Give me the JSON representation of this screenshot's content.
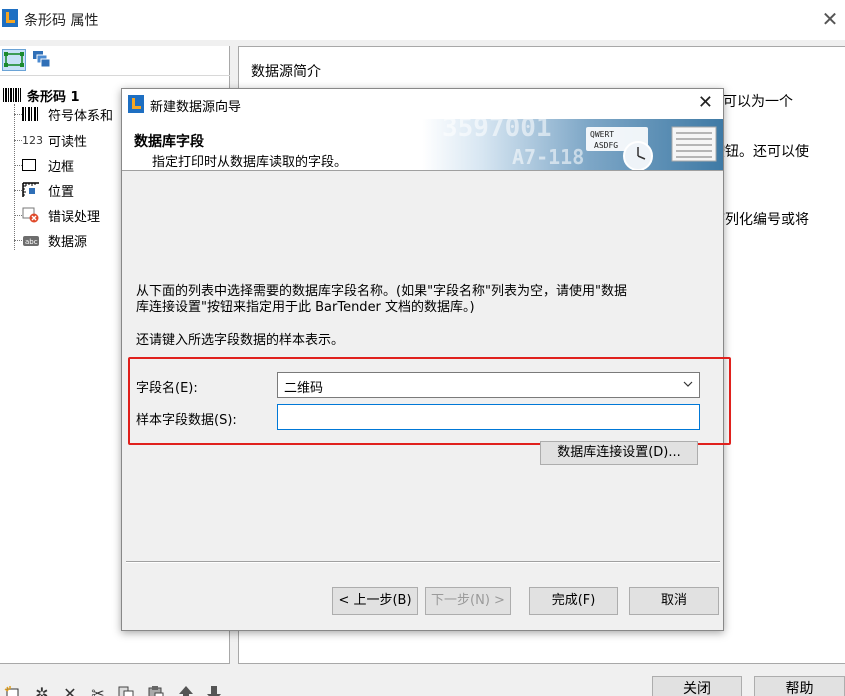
{
  "outer": {
    "title": "条形码 属性",
    "tree": {
      "root_label": "条形码 1",
      "items": [
        {
          "label": "符号体系和",
          "icon": "barcode-icon"
        },
        {
          "label": "可读性",
          "icon": "digits-icon"
        },
        {
          "label": "边框",
          "icon": "border-icon"
        },
        {
          "label": "位置",
          "icon": "position-icon"
        },
        {
          "label": "错误处理",
          "icon": "error-icon"
        },
        {
          "label": "数据源",
          "icon": "datasource-icon"
        }
      ]
    },
    "right_panel": {
      "heading": "数据源简介",
      "frag1": "上。可以为一个",
      "frag2": "按钮。还可以使",
      "frag3": "序列化编号或将"
    },
    "buttons": {
      "close": "关闭",
      "help": "帮助"
    }
  },
  "dialog": {
    "title": "新建数据源向导",
    "header_title": "数据库字段",
    "header_subtitle": "指定打印时从数据库读取的字段。",
    "banner_text1": "3597001",
    "banner_text2": "A7-118",
    "banner_keys1": "QWERT",
    "banner_keys2": "ASDFG",
    "instruction_line1": "从下面的列表中选择需要的数据库字段名称。(如果\"字段名称\"列表为空，请使用\"数据",
    "instruction_line2": "库连接设置\"按钮来指定用于此 BarTender 文档的数据库。)",
    "instruction2": "还请键入所选字段数据的样本表示。",
    "field_name_label": "字段名(E):",
    "field_name_value": "二维码",
    "sample_label": "样本字段数据(S):",
    "sample_value": "",
    "db_settings_button": "数据库连接设置(D)...",
    "back_button": "< 上一步(B)",
    "next_button": "下一步(N) >",
    "finish_button": "完成(F)",
    "cancel_button": "取消"
  }
}
